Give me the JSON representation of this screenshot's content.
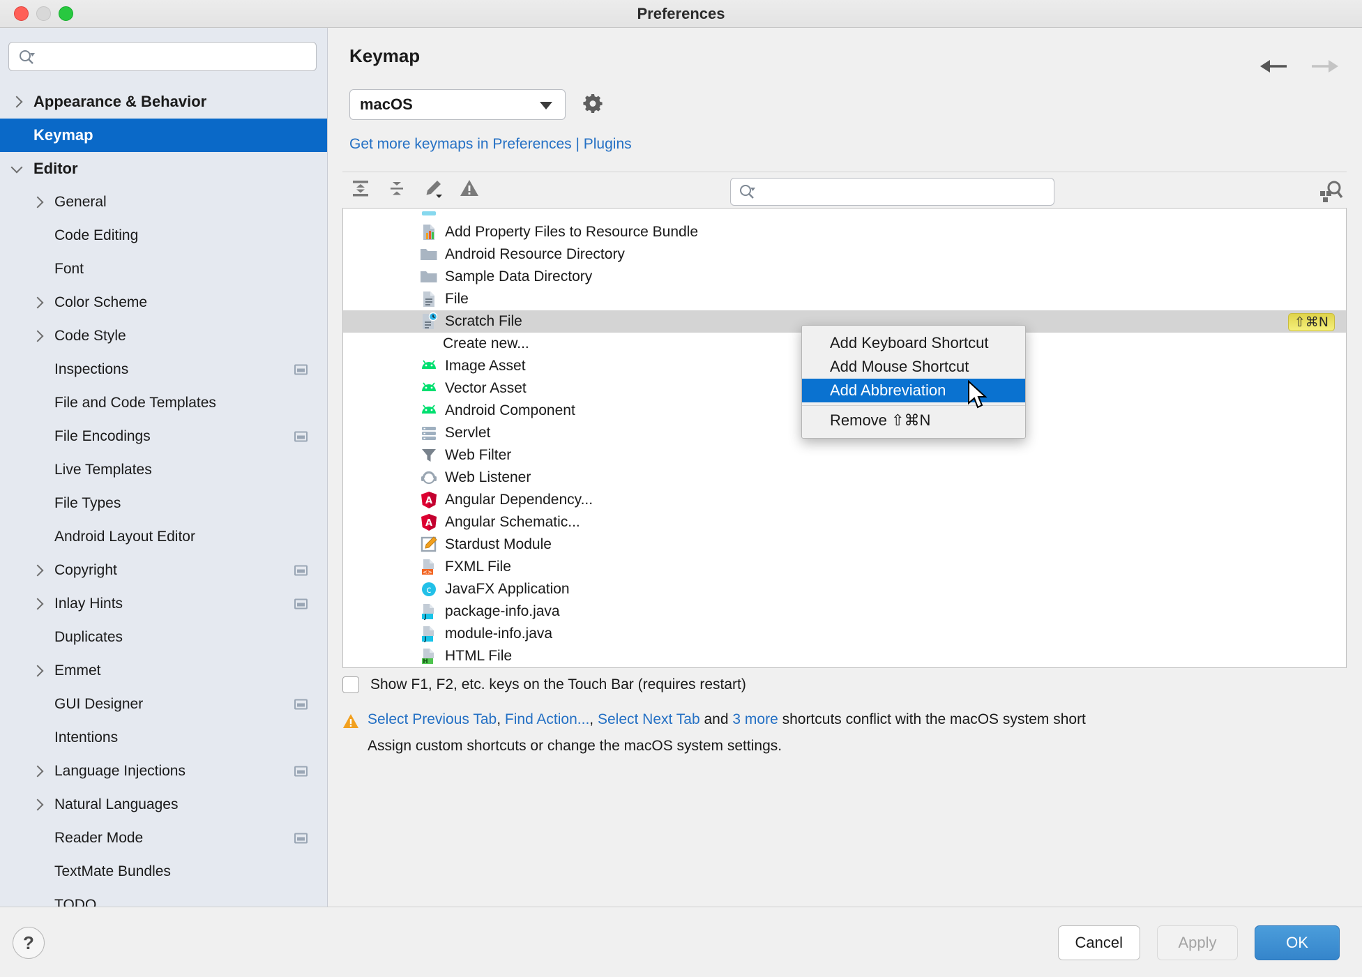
{
  "window": {
    "title": "Preferences"
  },
  "sidebar": {
    "search_placeholder": "",
    "items": [
      {
        "label": "Appearance & Behavior",
        "twisty": "right",
        "level": 1,
        "bold": true,
        "selected": false,
        "badge": false
      },
      {
        "label": "Keymap",
        "twisty": "none",
        "level": 1,
        "bold": true,
        "selected": true,
        "badge": false
      },
      {
        "label": "Editor",
        "twisty": "down",
        "level": 1,
        "bold": true,
        "selected": false,
        "badge": false
      },
      {
        "label": "General",
        "twisty": "right",
        "level": 2,
        "bold": false,
        "selected": false,
        "badge": false
      },
      {
        "label": "Code Editing",
        "twisty": "none",
        "level": 2,
        "bold": false,
        "selected": false,
        "badge": false
      },
      {
        "label": "Font",
        "twisty": "none",
        "level": 2,
        "bold": false,
        "selected": false,
        "badge": false
      },
      {
        "label": "Color Scheme",
        "twisty": "right",
        "level": 2,
        "bold": false,
        "selected": false,
        "badge": false
      },
      {
        "label": "Code Style",
        "twisty": "right",
        "level": 2,
        "bold": false,
        "selected": false,
        "badge": false
      },
      {
        "label": "Inspections",
        "twisty": "none",
        "level": 2,
        "bold": false,
        "selected": false,
        "badge": true
      },
      {
        "label": "File and Code Templates",
        "twisty": "none",
        "level": 2,
        "bold": false,
        "selected": false,
        "badge": false
      },
      {
        "label": "File Encodings",
        "twisty": "none",
        "level": 2,
        "bold": false,
        "selected": false,
        "badge": true
      },
      {
        "label": "Live Templates",
        "twisty": "none",
        "level": 2,
        "bold": false,
        "selected": false,
        "badge": false
      },
      {
        "label": "File Types",
        "twisty": "none",
        "level": 2,
        "bold": false,
        "selected": false,
        "badge": false
      },
      {
        "label": "Android Layout Editor",
        "twisty": "none",
        "level": 2,
        "bold": false,
        "selected": false,
        "badge": false
      },
      {
        "label": "Copyright",
        "twisty": "right",
        "level": 2,
        "bold": false,
        "selected": false,
        "badge": true
      },
      {
        "label": "Inlay Hints",
        "twisty": "right",
        "level": 2,
        "bold": false,
        "selected": false,
        "badge": true
      },
      {
        "label": "Duplicates",
        "twisty": "none",
        "level": 2,
        "bold": false,
        "selected": false,
        "badge": false
      },
      {
        "label": "Emmet",
        "twisty": "right",
        "level": 2,
        "bold": false,
        "selected": false,
        "badge": false
      },
      {
        "label": "GUI Designer",
        "twisty": "none",
        "level": 2,
        "bold": false,
        "selected": false,
        "badge": true
      },
      {
        "label": "Intentions",
        "twisty": "none",
        "level": 2,
        "bold": false,
        "selected": false,
        "badge": false
      },
      {
        "label": "Language Injections",
        "twisty": "right",
        "level": 2,
        "bold": false,
        "selected": false,
        "badge": true
      },
      {
        "label": "Natural Languages",
        "twisty": "right",
        "level": 2,
        "bold": false,
        "selected": false,
        "badge": false
      },
      {
        "label": "Reader Mode",
        "twisty": "none",
        "level": 2,
        "bold": false,
        "selected": false,
        "badge": true
      },
      {
        "label": "TextMate Bundles",
        "twisty": "none",
        "level": 2,
        "bold": false,
        "selected": false,
        "badge": false
      },
      {
        "label": "TODO",
        "twisty": "none",
        "level": 2,
        "bold": false,
        "selected": false,
        "badge": false
      }
    ]
  },
  "main": {
    "page_title": "Keymap",
    "keymap_select": {
      "value": "macOS"
    },
    "get_more_link": "Get more keymaps in Preferences | Plugins",
    "toolbar": {
      "expand_all": "expand-all",
      "collapse_all": "collapse-all",
      "edit_shortcut": "edit-shortcut",
      "conflicts": "conflicts",
      "search_placeholder": "",
      "find_by_shortcut": "find-by-shortcut"
    },
    "rows": [
      {
        "icon": "resource-bundle",
        "label": "Add Property Files to Resource Bundle",
        "shortcut": "",
        "selected": false,
        "sub": false
      },
      {
        "icon": "folder",
        "label": "Android Resource Directory",
        "shortcut": "",
        "selected": false,
        "sub": false
      },
      {
        "icon": "folder",
        "label": "Sample Data Directory",
        "shortcut": "",
        "selected": false,
        "sub": false
      },
      {
        "icon": "file",
        "label": "File",
        "shortcut": "",
        "selected": false,
        "sub": false
      },
      {
        "icon": "scratch-file",
        "label": "Scratch File",
        "shortcut": "⇧⌘N",
        "selected": true,
        "sub": false
      },
      {
        "icon": "none",
        "label": "Create new...",
        "shortcut": "",
        "selected": false,
        "sub": true
      },
      {
        "icon": "android",
        "label": "Image Asset",
        "shortcut": "",
        "selected": false,
        "sub": false
      },
      {
        "icon": "android",
        "label": "Vector Asset",
        "shortcut": "",
        "selected": false,
        "sub": false
      },
      {
        "icon": "android",
        "label": "Android Component",
        "shortcut": "",
        "selected": false,
        "sub": false
      },
      {
        "icon": "servlet",
        "label": "Servlet",
        "shortcut": "",
        "selected": false,
        "sub": false
      },
      {
        "icon": "filter",
        "label": "Web Filter",
        "shortcut": "",
        "selected": false,
        "sub": false
      },
      {
        "icon": "listener",
        "label": "Web Listener",
        "shortcut": "",
        "selected": false,
        "sub": false
      },
      {
        "icon": "angular",
        "label": "Angular Dependency...",
        "shortcut": "",
        "selected": false,
        "sub": false
      },
      {
        "icon": "angular",
        "label": "Angular Schematic...",
        "shortcut": "",
        "selected": false,
        "sub": false
      },
      {
        "icon": "stardust",
        "label": "Stardust Module",
        "shortcut": "",
        "selected": false,
        "sub": false
      },
      {
        "icon": "fxml",
        "label": "FXML File",
        "shortcut": "",
        "selected": false,
        "sub": false
      },
      {
        "icon": "javafx",
        "label": "JavaFX Application",
        "shortcut": "",
        "selected": false,
        "sub": false
      },
      {
        "icon": "java-file",
        "label": "package-info.java",
        "shortcut": "",
        "selected": false,
        "sub": false
      },
      {
        "icon": "java-file",
        "label": "module-info.java",
        "shortcut": "",
        "selected": false,
        "sub": false
      },
      {
        "icon": "html-file",
        "label": "HTML File",
        "shortcut": "",
        "selected": false,
        "sub": false
      }
    ],
    "context_menu": {
      "items": [
        {
          "label": "Add Keyboard Shortcut",
          "highlighted": false,
          "separator_after": false
        },
        {
          "label": "Add Mouse Shortcut",
          "highlighted": false,
          "separator_after": false
        },
        {
          "label": "Add Abbreviation",
          "highlighted": true,
          "separator_after": true
        },
        {
          "label": "Remove ⇧⌘N",
          "highlighted": false,
          "separator_after": false
        }
      ]
    },
    "touchbar_checkbox": {
      "label": "Show F1, F2, etc. keys on the Touch Bar (requires restart)",
      "checked": false
    },
    "conflict_warning": {
      "link1": "Select Previous Tab",
      "sep1": ", ",
      "link2": "Find Action...",
      "sep2": ", ",
      "link3": "Select Next Tab",
      "mid": " and ",
      "link4": "3 more",
      "tail": " shortcuts conflict with the macOS system short",
      "line2": "Assign custom shortcuts or change the macOS system settings."
    }
  },
  "footer": {
    "help_label": "?",
    "cancel_label": "Cancel",
    "apply_label": "Apply",
    "ok_label": "OK"
  },
  "colors": {
    "accent_blue": "#0a69c8",
    "menu_highlight": "#0a72d0",
    "link_blue": "#2470c4",
    "shortcut_badge": "#f5f07c",
    "warning_amber": "#f2a01e",
    "ok_button": "#3585cb"
  }
}
